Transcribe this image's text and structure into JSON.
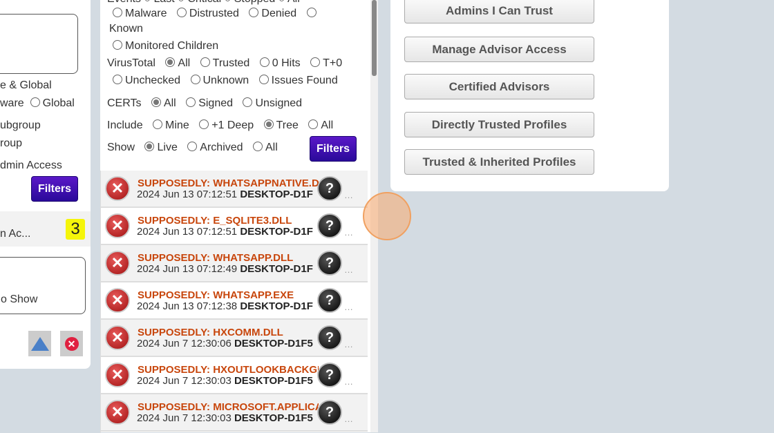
{
  "left": {
    "lines": [
      "e & Global",
      "ware",
      "Global",
      "ubgroup",
      "roup",
      "dmin Access"
    ],
    "filters_label": "Filters",
    "item_label": "n Ac...",
    "badge": "3",
    "box_text": "o Show"
  },
  "filters": {
    "events_row": "Events  ○ Last  ○ Critical  ○ Stopped  ○ All",
    "events": [
      "Malware",
      "Distrusted",
      "Denied",
      "Known",
      "Monitored Children"
    ],
    "virustotal_label": "VirusTotal",
    "virustotal": [
      "All",
      "Trusted",
      "0 Hits",
      "T+0",
      "Unchecked",
      "Unknown",
      "Issues Found"
    ],
    "certs_label": "CERTs",
    "certs": [
      "All",
      "Signed",
      "Unsigned"
    ],
    "include_label": "Include",
    "include": [
      "Mine",
      "+1 Deep",
      "Tree",
      "All"
    ],
    "show_label": "Show",
    "show": [
      "Live",
      "Archived",
      "All"
    ],
    "filters_label": "Filters"
  },
  "rows": [
    {
      "title": "SUPPOSEDLY: WHATSAPPNATIVE.DLL",
      "time": "2024 Jun 13 07:12:51",
      "host": "DESKTOP-D1F"
    },
    {
      "title": "SUPPOSEDLY: E_SQLITE3.DLL",
      "time": "2024 Jun 13 07:12:51",
      "host": "DESKTOP-D1F"
    },
    {
      "title": "SUPPOSEDLY: WHATSAPP.DLL",
      "time": "2024 Jun 13 07:12:49",
      "host": "DESKTOP-D1F"
    },
    {
      "title": "SUPPOSEDLY: WHATSAPP.EXE",
      "time": "2024 Jun 13 07:12:38",
      "host": "DESKTOP-D1F"
    },
    {
      "title": "SUPPOSEDLY: HXCOMM.DLL",
      "time": "2024 Jun 7 12:30:06",
      "host": "DESKTOP-D1F5"
    },
    {
      "title": "SUPPOSEDLY: HXOUTLOOKBACKGROUNDHOST",
      "time": "2024 Jun 7 12:30:03",
      "host": "DESKTOP-D1F5"
    },
    {
      "title": "SUPPOSEDLY: MICROSOFT.APPLICATION",
      "time": "2024 Jun 7 12:30:03",
      "host": "DESKTOP-D1F5"
    }
  ],
  "right": {
    "buttons": [
      "Admins I Can Trust",
      "Manage Advisor Access",
      "Certified Advisors",
      "Directly Trusted Profiles",
      "Trusted & Inherited Profiles"
    ]
  }
}
